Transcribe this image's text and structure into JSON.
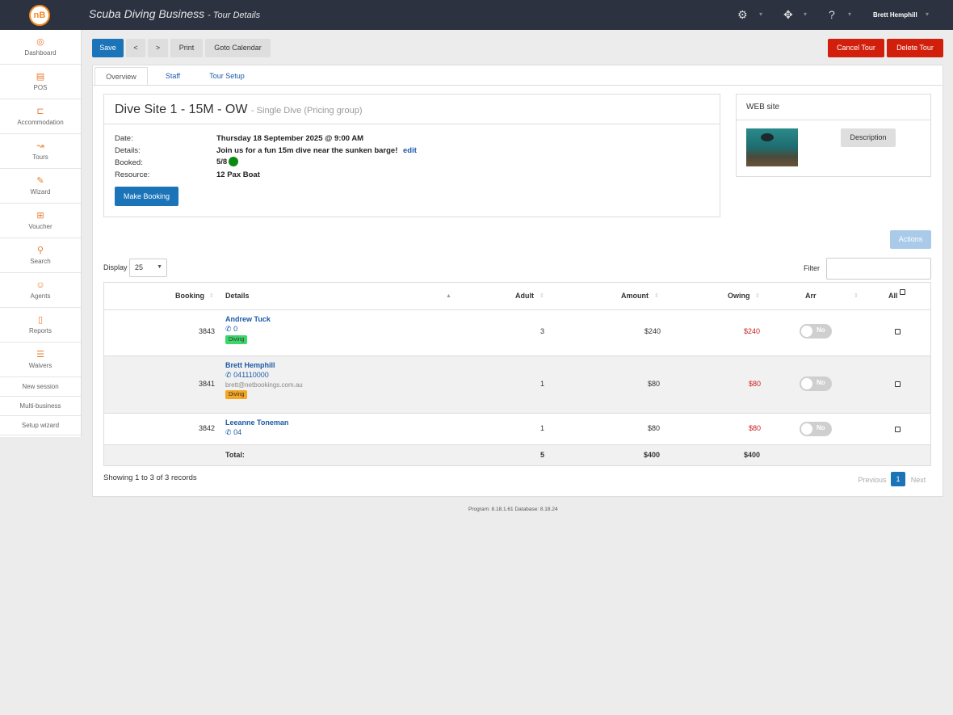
{
  "header": {
    "app_name": "Scuba Diving Business",
    "page": "- Tour Details",
    "user": "Brett Hemphill",
    "logo_text": "nB"
  },
  "sidebar": {
    "items": [
      {
        "label": "Dashboard",
        "icon": "dashboard-icon"
      },
      {
        "label": "POS",
        "icon": "pos-icon"
      },
      {
        "label": "Accommodation",
        "icon": "bed-icon"
      },
      {
        "label": "Tours",
        "icon": "route-icon"
      },
      {
        "label": "Wizard",
        "icon": "magic-wand-icon"
      },
      {
        "label": "Voucher",
        "icon": "gift-icon"
      },
      {
        "label": "Search",
        "icon": "search-icon"
      },
      {
        "label": "Agents",
        "icon": "users-icon"
      },
      {
        "label": "Reports",
        "icon": "document-icon"
      },
      {
        "label": "Waivers",
        "icon": "checklist-icon"
      }
    ],
    "links": [
      "New session",
      "Multi-business",
      "Setup wizard"
    ]
  },
  "toolbar": {
    "save": "Save",
    "prev": "<",
    "next": ">",
    "print": "Print",
    "goto_calendar": "Goto Calendar",
    "cancel_tour": "Cancel Tour",
    "delete_tour": "Delete Tour"
  },
  "tabs": [
    "Overview",
    "Staff",
    "Tour Setup"
  ],
  "tour": {
    "title": "Dive Site 1 - 15M - OW",
    "subtitle": "- Single Dive (Pricing group)",
    "labels": {
      "date": "Date:",
      "details": "Details:",
      "booked": "Booked:",
      "resource": "Resource:"
    },
    "date": "Thursday 18 September 2025 @ 9:00 AM",
    "details": "Join us for a fun 15m dive near the sunken barge!",
    "edit": "edit",
    "booked": "5/8",
    "resource": "12 Pax Boat",
    "make_booking": "Make Booking"
  },
  "web": {
    "title": "WEB site",
    "description_button": "Description"
  },
  "list_controls": {
    "actions": "Actions",
    "display_label": "Display",
    "display_value": "25",
    "filter_label": "Filter",
    "filter_value": ""
  },
  "table": {
    "headers": {
      "booking": "Booking",
      "details": "Details",
      "adult": "Adult",
      "amount": "Amount",
      "owing": "Owing",
      "arr": "Arr",
      "all": "All"
    },
    "rows": [
      {
        "booking": "3843",
        "name": "Andrew Tuck",
        "phone": "0",
        "email": "",
        "tag": "Diving",
        "tag_color": "#3dd66b",
        "adult": "3",
        "amount": "$240",
        "owing": "$240",
        "arr": "No"
      },
      {
        "booking": "3841",
        "name": "Brett Hemphill",
        "phone": "041110000",
        "email": "brett@netbookings.com.au",
        "tag": "Diving",
        "tag_color": "#f5a623",
        "adult": "1",
        "amount": "$80",
        "owing": "$80",
        "arr": "No"
      },
      {
        "booking": "3842",
        "name": "Leeanne Toneman",
        "phone": "04",
        "email": "",
        "tag": "",
        "tag_color": "",
        "adult": "1",
        "amount": "$80",
        "owing": "$80",
        "arr": "No"
      }
    ],
    "total": {
      "label": "Total:",
      "adult": "5",
      "amount": "$400",
      "owing": "$400"
    }
  },
  "pagination": {
    "summary": "Showing 1 to 3 of 3 records",
    "previous": "Previous",
    "current": "1",
    "next": "Next"
  },
  "footer": {
    "version": "Program: 8.18.1.61 Database: 8.18.24"
  },
  "colors": {
    "primary": "#1b73b8",
    "danger": "#d11f0c",
    "owing": "#cc1f1f",
    "accent": "#e8792b",
    "topbar": "#2d3241"
  }
}
